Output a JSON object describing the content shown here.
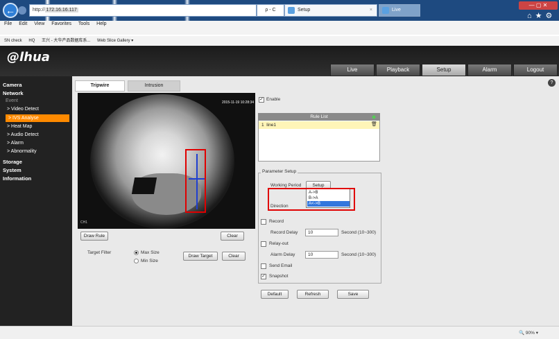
{
  "browser": {
    "address": {
      "prefix": "http://",
      "host": "172.16.16.117"
    },
    "address_tools": "ρ - C",
    "tabs": [
      {
        "label": "Setup"
      },
      {
        "label": "Live"
      }
    ],
    "menu": [
      "File",
      "Edit",
      "View",
      "Favorites",
      "Tools",
      "Help"
    ],
    "favorites": [
      "SN check",
      "HQ",
      "王兴 - 大华产品数据库系...",
      "Web Slice Gallery ▾"
    ],
    "zoom": "90%"
  },
  "app": {
    "logo": "alhua",
    "top_nav": [
      {
        "label": "Live",
        "active": false
      },
      {
        "label": "Playback",
        "active": false
      },
      {
        "label": "Setup",
        "active": true
      },
      {
        "label": "Alarm",
        "active": false
      },
      {
        "label": "Logout",
        "active": false
      }
    ]
  },
  "sidebar": {
    "items": [
      {
        "label": "Camera",
        "style": "bold"
      },
      {
        "label": "Network",
        "style": "bold"
      },
      {
        "label": "Event",
        "style": "dim"
      },
      {
        "label": "> Video Detect",
        "style": "sub"
      },
      {
        "label": "> IVS Analyse",
        "style": "selected"
      },
      {
        "label": "> Heat Map",
        "style": "sub"
      },
      {
        "label": "> Audio Detect",
        "style": "sub"
      },
      {
        "label": "> Alarm",
        "style": "sub"
      },
      {
        "label": "> Abnormality",
        "style": "sub"
      },
      {
        "label": "Storage",
        "style": "bold"
      },
      {
        "label": "System",
        "style": "bold"
      },
      {
        "label": "Information",
        "style": "bold"
      }
    ]
  },
  "page_tabs": [
    {
      "label": "Tripwire",
      "active": true
    },
    {
      "label": "Intrusion",
      "active": false
    }
  ],
  "video": {
    "timestamp": "2015-11-19 10:28:34",
    "channel": "CH1"
  },
  "left_controls": {
    "draw_rule": "Draw Rule",
    "clear": "Clear",
    "target_filter_label": "Target Filter",
    "max_size": "Max Size",
    "min_size": "Min Size",
    "draw_target": "Draw Target",
    "clear2": "Clear"
  },
  "right_panel": {
    "enable": "Enable",
    "rule_list_title": "Rule List",
    "rules": [
      {
        "index": "1",
        "name": "line1"
      }
    ],
    "param_setup": "Parameter Setup",
    "working_period": "Working Period",
    "setup_btn": "Setup",
    "direction": "Direction",
    "direction_options": [
      "A->B",
      "B->A",
      "A<->B"
    ],
    "direction_selected_index": 2,
    "record": "Record",
    "record_delay_label": "Record Delay",
    "record_delay_value": "10",
    "record_delay_unit": "Second (10~300)",
    "relay_out": "Relay-out",
    "alarm_delay_label": "Alarm Delay",
    "alarm_delay_value": "10",
    "alarm_delay_unit": "Second (10~300)",
    "send_email": "Send Email",
    "snapshot": "Snapshot",
    "default_btn": "Default",
    "refresh_btn": "Refresh",
    "save_btn": "Save"
  },
  "colors": {
    "accent": "#ff8a00",
    "highlight_box": "#e00000",
    "tripwire": "#1f3fd0"
  }
}
